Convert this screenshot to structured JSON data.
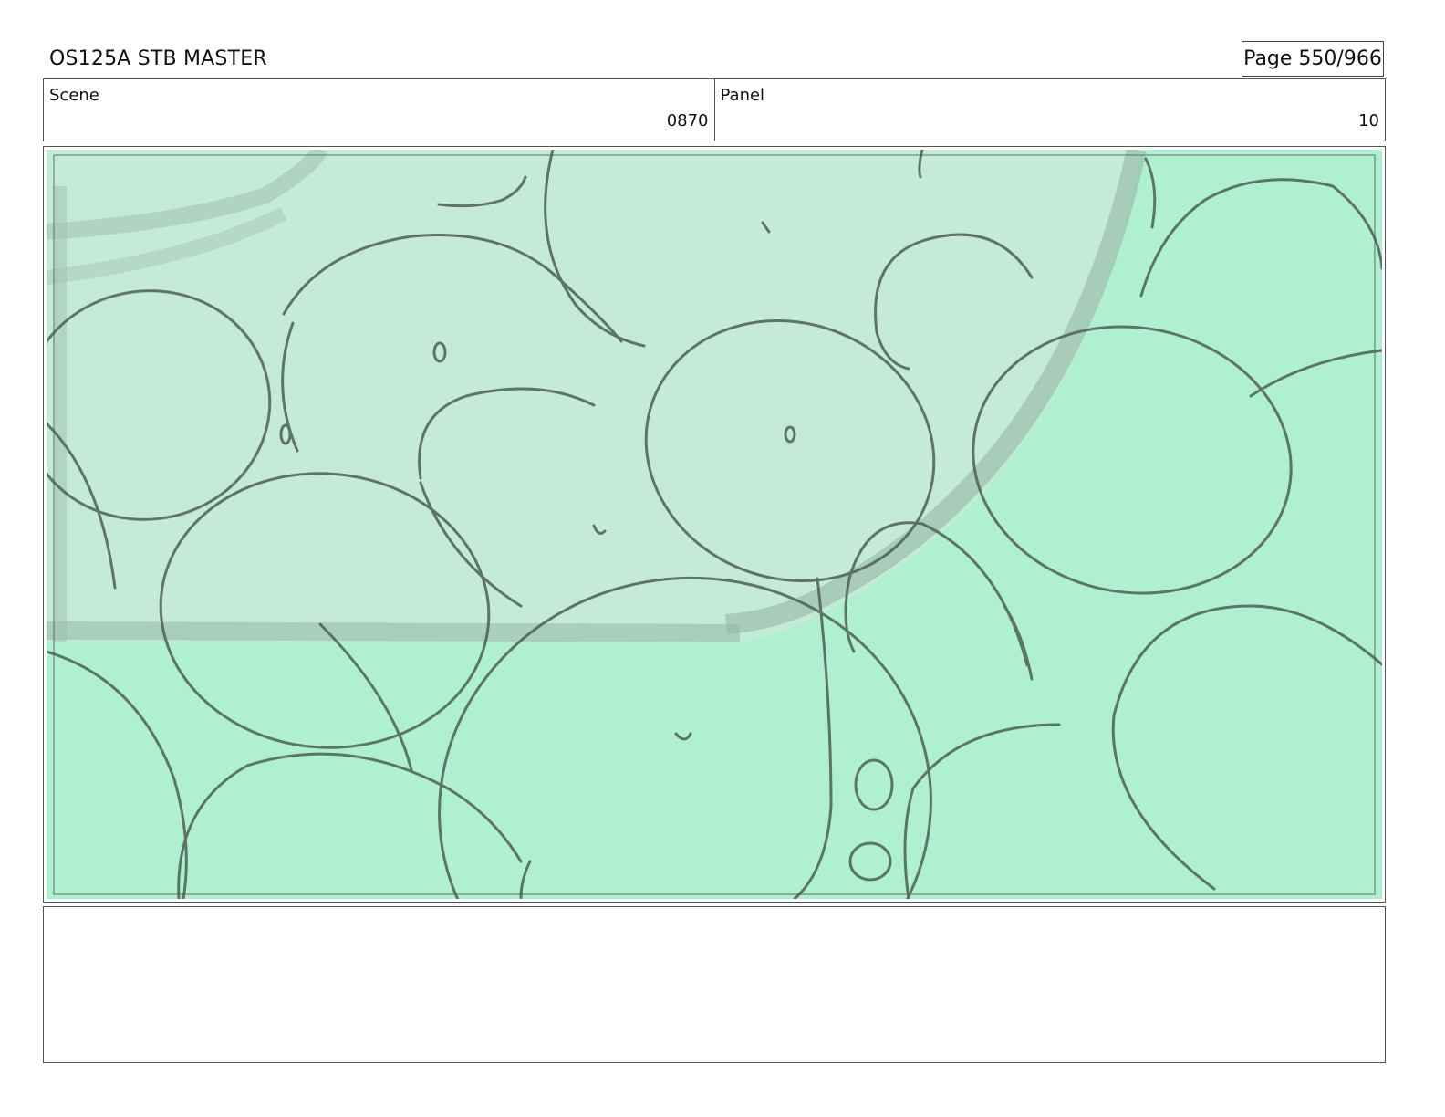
{
  "header": {
    "title": "OS125A STB MASTER",
    "page_label": "Page 550/966"
  },
  "info": {
    "scene_label": "Scene",
    "scene_value": "0870",
    "panel_label": "Panel",
    "panel_value": "10"
  },
  "artwork": {
    "description_icon": "storyboard-sketch-bubbles",
    "colors": {
      "background_green": "#aff0d1",
      "overlay_light_green": "#c2ecd8",
      "line_gray": "#4d5f56"
    }
  },
  "notes": {
    "text": ""
  }
}
